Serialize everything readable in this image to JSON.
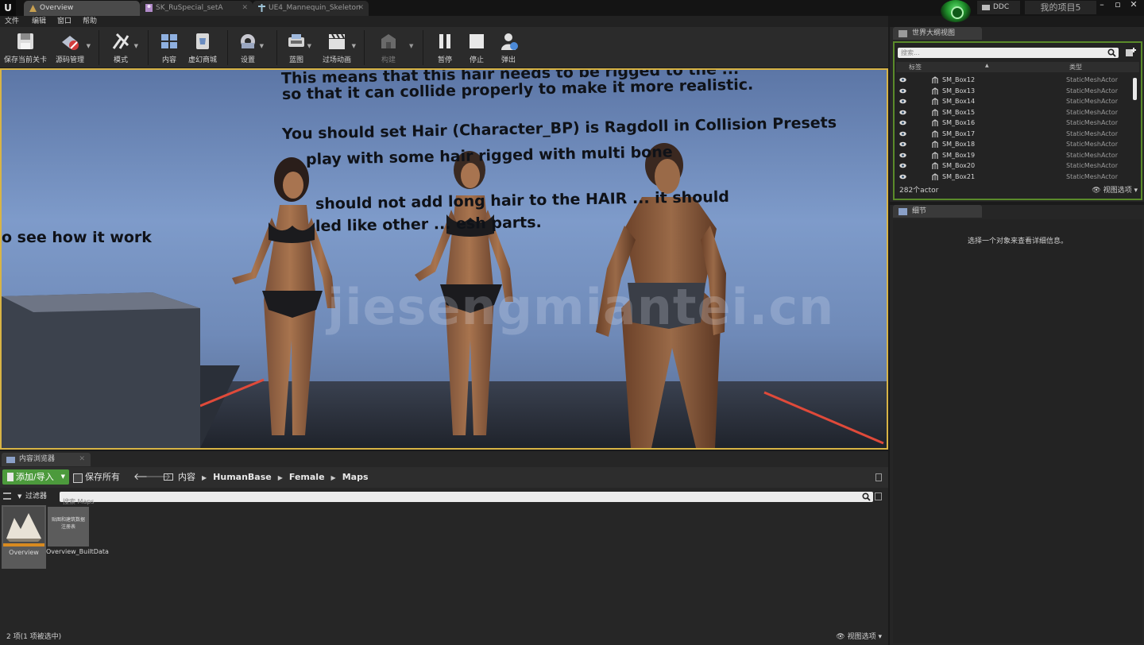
{
  "tabs": [
    {
      "label": "Overview",
      "active": true
    },
    {
      "label": "SK_RuSpecial_setA",
      "active": false
    },
    {
      "label": "UE4_Mannequin_Skeleton",
      "active": false
    }
  ],
  "title_bar": {
    "ddc_label": "DDC",
    "project_name": "我的项目5"
  },
  "menu": [
    "文件",
    "编辑",
    "窗口",
    "帮助"
  ],
  "toolbar": [
    {
      "label": "保存当前关卡",
      "icon": "save-icon"
    },
    {
      "label": "源码管理",
      "icon": "source-control-icon"
    },
    {
      "label": "模式",
      "icon": "modes-icon"
    },
    {
      "label": "内容",
      "icon": "content-icon"
    },
    {
      "label": "虚幻商城",
      "icon": "marketplace-icon"
    },
    {
      "label": "设置",
      "icon": "settings-icon"
    },
    {
      "label": "蓝图",
      "icon": "blueprint-icon"
    },
    {
      "label": "过场动画",
      "icon": "cinematics-icon"
    },
    {
      "label": "构建",
      "icon": "build-icon"
    },
    {
      "label": "暂停",
      "icon": "pause-icon"
    },
    {
      "label": "停止",
      "icon": "stop-icon"
    },
    {
      "label": "弹出",
      "icon": "eject-icon"
    }
  ],
  "viewport": {
    "text_lines": [
      "This means that this hair needs to be rigged to the ...",
      "so that it can collide properly to make it more realistic.",
      "You should set Hair (Character_BP) is Ragdoll in Collision Presets",
      "play with some hair rigged with multi bone",
      "should not add long hair to the HAIR ... it should",
      "led like other ... esh parts.",
      "o see how it work"
    ],
    "watermark": "jiesengmiantei.cn"
  },
  "outliner": {
    "tab_label": "世界大纲视图",
    "search_placeholder": "搜索...",
    "col_label": "标签",
    "col_type": "类型",
    "rows": [
      {
        "name": "SM_Box12",
        "type": "StaticMeshActor"
      },
      {
        "name": "SM_Box13",
        "type": "StaticMeshActor"
      },
      {
        "name": "SM_Box14",
        "type": "StaticMeshActor"
      },
      {
        "name": "SM_Box15",
        "type": "StaticMeshActor"
      },
      {
        "name": "SM_Box16",
        "type": "StaticMeshActor"
      },
      {
        "name": "SM_Box17",
        "type": "StaticMeshActor"
      },
      {
        "name": "SM_Box18",
        "type": "StaticMeshActor"
      },
      {
        "name": "SM_Box19",
        "type": "StaticMeshActor"
      },
      {
        "name": "SM_Box20",
        "type": "StaticMeshActor"
      },
      {
        "name": "SM_Box21",
        "type": "StaticMeshActor"
      }
    ],
    "count": "282个actor",
    "view_options": "视图选项"
  },
  "details": {
    "tab_label": "细节",
    "message": "选择一个对象来查看详细信息。"
  },
  "content_browser": {
    "tab_label": "内容浏览器",
    "add_import": "添加/导入",
    "save_all": "保存所有",
    "breadcrumbs": [
      "内容",
      "HumanBase",
      "Female",
      "Maps"
    ],
    "filter_label": "过滤器",
    "search_placeholder": "搜索 Maps",
    "assets": [
      {
        "name": "Overview",
        "thumb_text": "",
        "selected": true
      },
      {
        "name": "Overview_BuiltData",
        "thumb_text": "贴图和建筑数据注册表",
        "selected": false
      }
    ],
    "status": "2 项(1 项被选中)",
    "view_options": "视图选项"
  },
  "colors": {
    "accent_gold": "#d8b445",
    "outliner_border": "#5a8a2a",
    "add_button": "#4c9a3c"
  }
}
